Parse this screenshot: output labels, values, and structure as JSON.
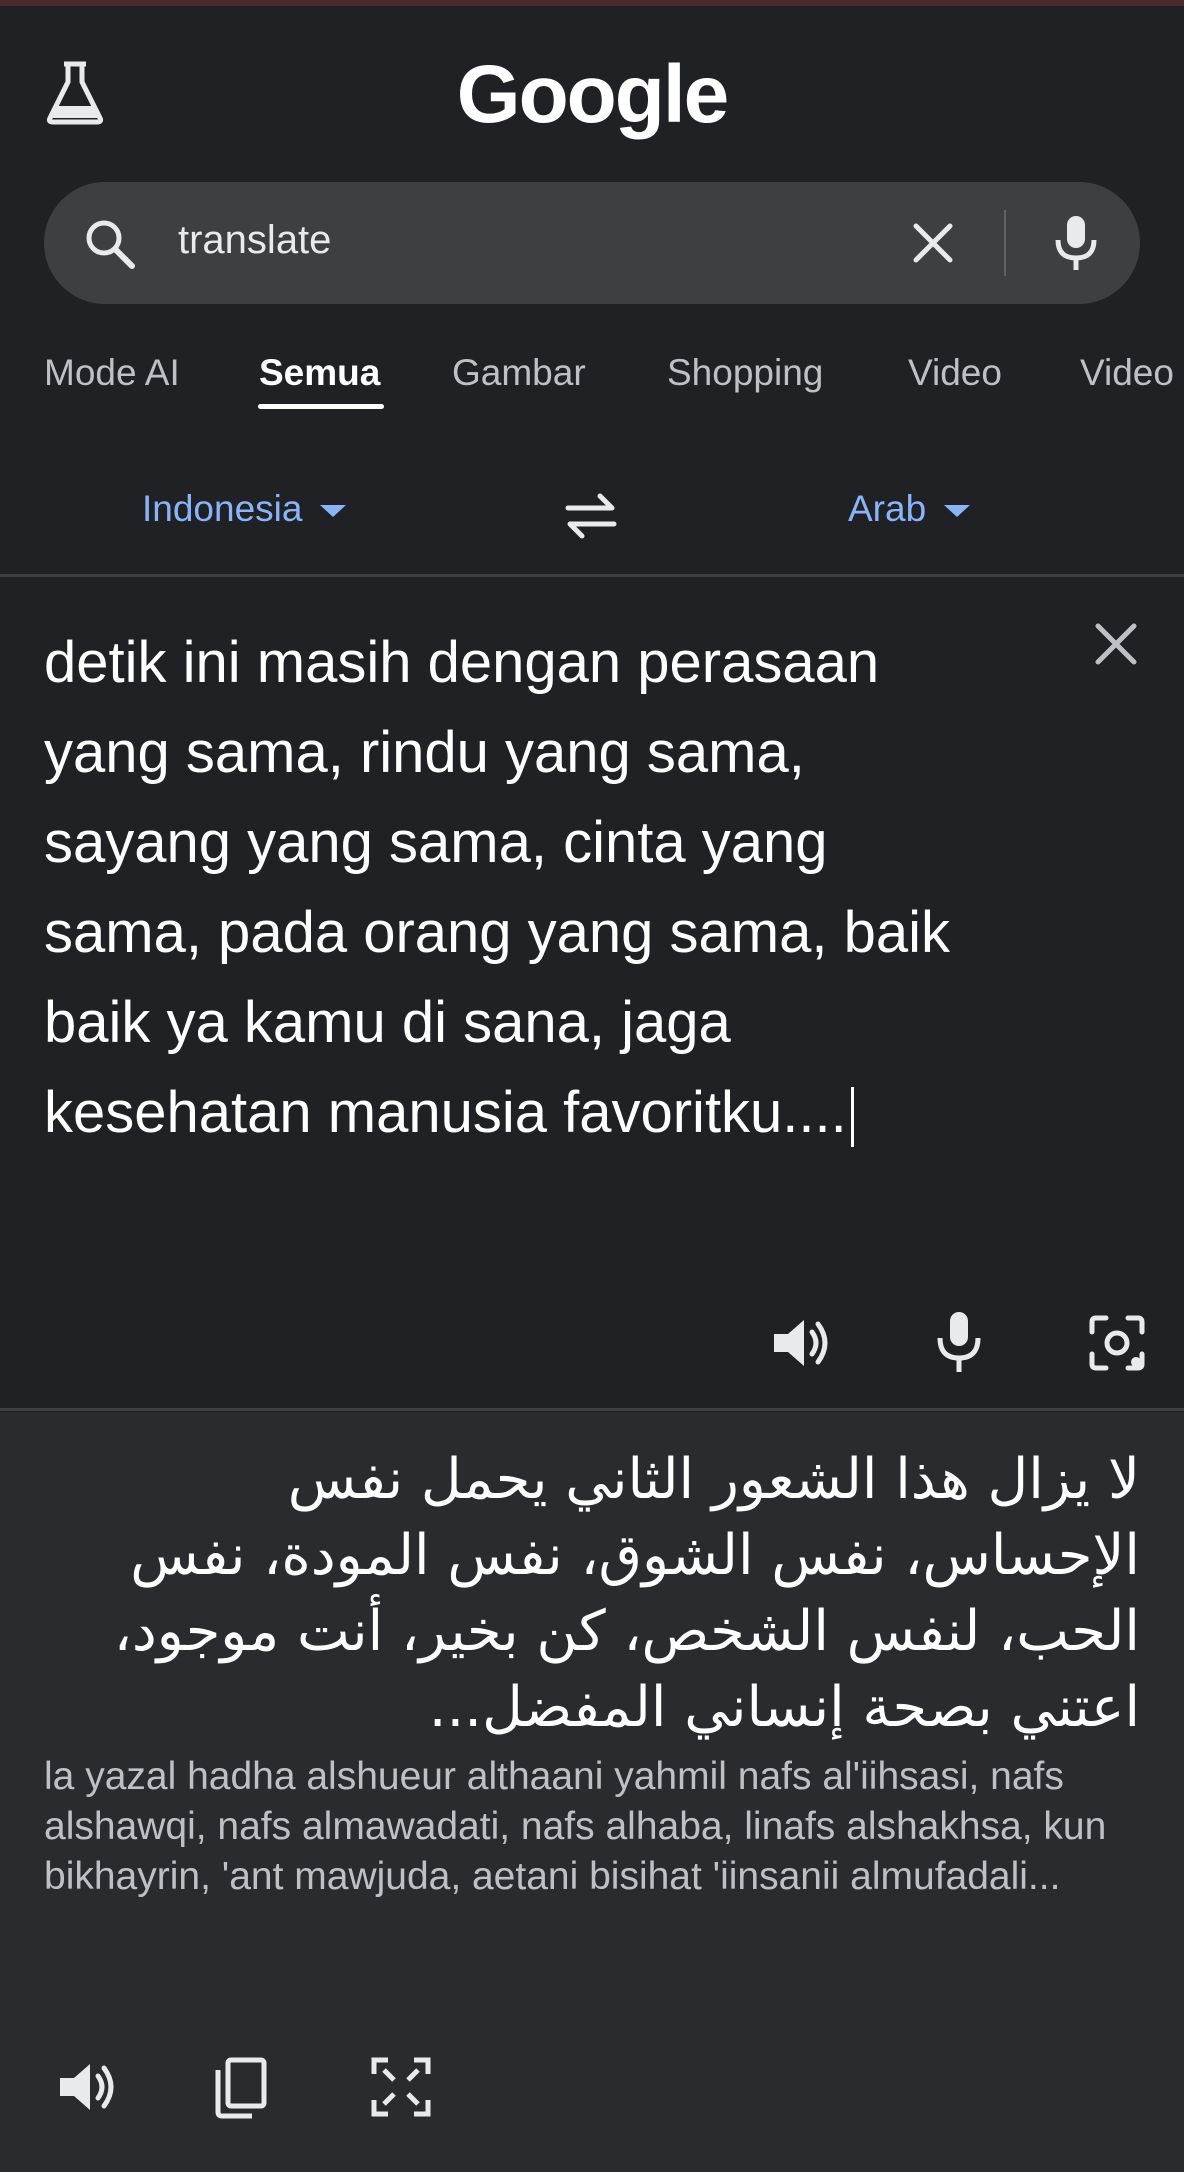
{
  "header": {
    "logo": "Google"
  },
  "search": {
    "query": "translate"
  },
  "tabs": [
    {
      "label": "Mode AI"
    },
    {
      "label": "Semua"
    },
    {
      "label": "Gambar"
    },
    {
      "label": "Shopping"
    },
    {
      "label": "Video"
    },
    {
      "label": "Video"
    }
  ],
  "active_tab": "Semua",
  "translator": {
    "source_lang": "Indonesia",
    "target_lang": "Arab",
    "source_text": "detik ini masih dengan perasaan yang sama, rindu yang sama, sayang yang sama, cinta yang sama, pada orang yang sama, baik baik ya kamu di sana, jaga kesehatan manusia favoritku....",
    "translation": "لا يزال هذا الشعور الثاني يحمل نفس الإحساس، نفس الشوق، نفس المودة، نفس الحب، لنفس الشخص، كن بخير، أنت موجود، اعتني بصحة إنساني المفضل...",
    "transliteration": "la yazal hadha alshueur althaani yahmil nafs al'iihsasi, nafs alshawqi, nafs almawadati, nafs alhaba, linafs alshakhsa, kun bikhayrin, 'ant mawjuda, aetani bisihat 'iinsanii almufadali..."
  },
  "colors": {
    "background": "#202124",
    "accent": "#8ab4f8",
    "searchbar": "#3c4043"
  },
  "icons": [
    "labs-flask-icon",
    "search-icon",
    "clear-icon",
    "mic-icon",
    "swap-icon",
    "caret-down-icon",
    "speaker-icon",
    "camera-lens-icon",
    "copy-icon",
    "fullscreen-icon"
  ]
}
